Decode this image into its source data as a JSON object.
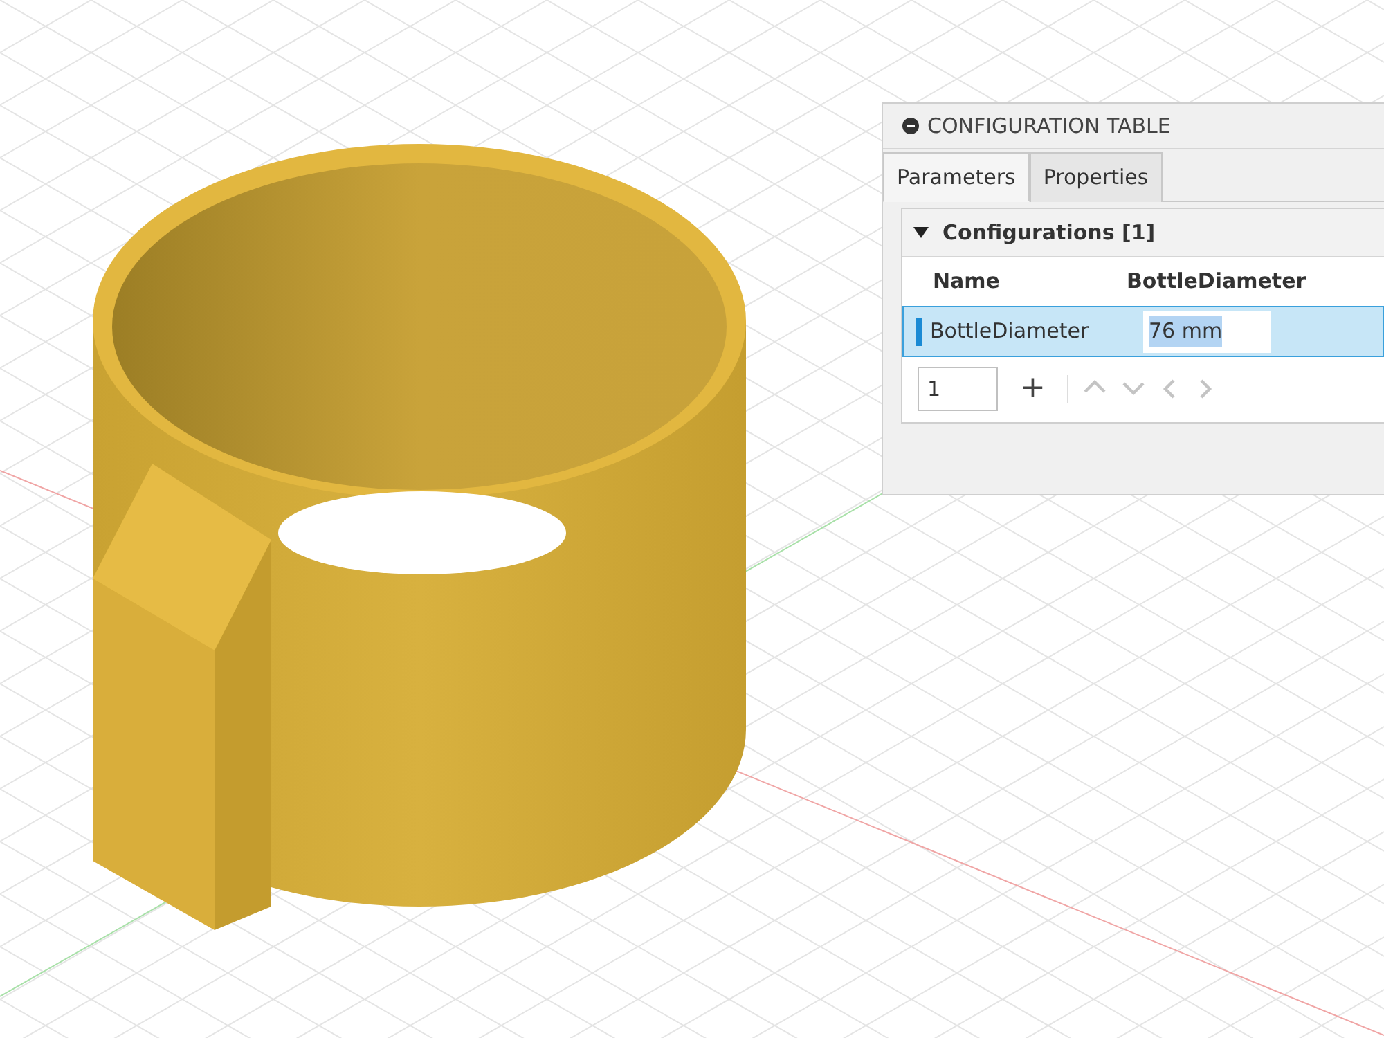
{
  "panel": {
    "title": "CONFIGURATION TABLE",
    "tabs": [
      {
        "label": "Parameters",
        "selected": true
      },
      {
        "label": "Properties",
        "selected": false
      }
    ],
    "section": {
      "title": "Configurations [1]",
      "expanded": true
    },
    "columns": [
      "Name",
      "BottleDiameter"
    ],
    "rows": [
      {
        "name": "BottleDiameter",
        "value": "76 mm",
        "selected": true
      }
    ],
    "footer": {
      "count": "1",
      "add": "+"
    }
  }
}
